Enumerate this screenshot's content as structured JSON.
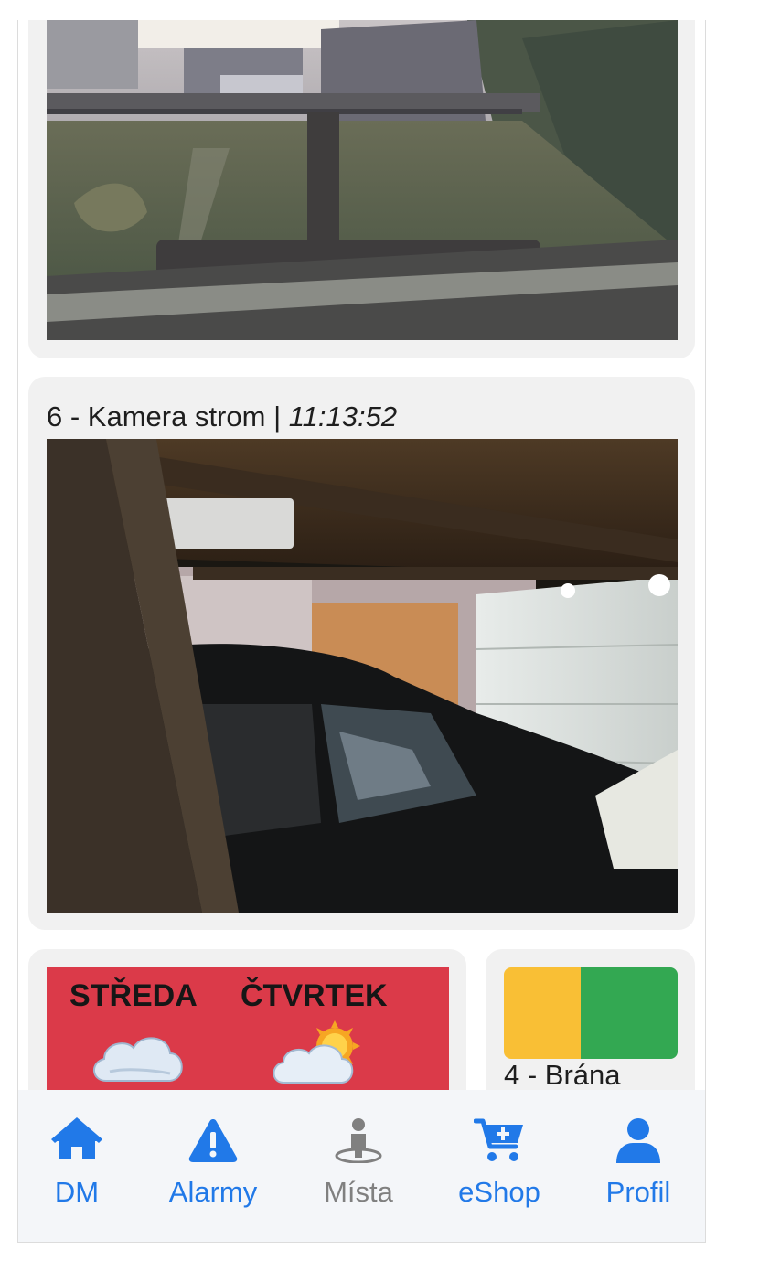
{
  "colors": {
    "accent": "#2179e8",
    "muted": "#808080",
    "weather_bg": "#db3a49",
    "status_left": "#f9bf35",
    "status_right": "#33a852"
  },
  "camera_6": {
    "title": "6 - Kamera strom",
    "separator": " | ",
    "time": "11:13:52"
  },
  "weather": {
    "days": [
      "STŘEDA",
      "ČTVRTEK"
    ],
    "icons": [
      "cloud-icon",
      "sun-cloud-icon"
    ]
  },
  "gate": {
    "label": "4 - Brána"
  },
  "tabs": [
    {
      "label": "DM",
      "icon": "home-icon",
      "active": true
    },
    {
      "label": "Alarmy",
      "icon": "warning-icon",
      "active": true
    },
    {
      "label": "Místa",
      "icon": "person-pin-icon",
      "active": false
    },
    {
      "label": "eShop",
      "icon": "cart-plus-icon",
      "active": true
    },
    {
      "label": "Profil",
      "icon": "user-icon",
      "active": true
    }
  ]
}
